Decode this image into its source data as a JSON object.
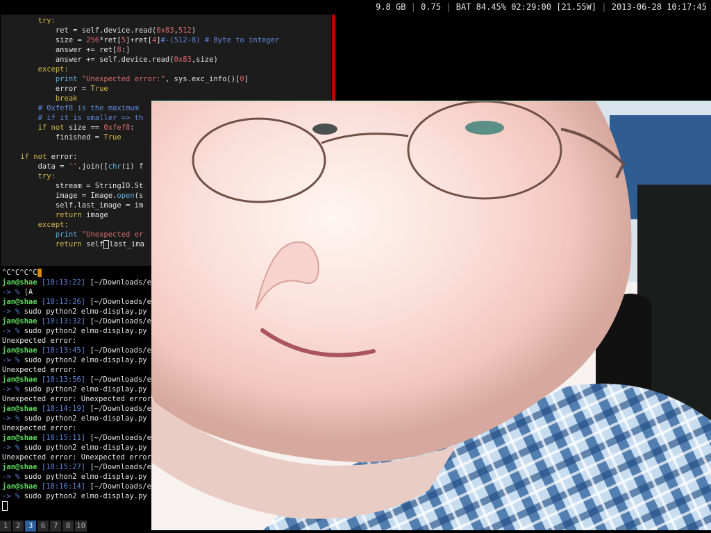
{
  "status": {
    "memory": "9.8 GB",
    "load": "0.75",
    "battery": "BAT 84.45% 02:29:00 [21.55W]",
    "datetime": "2013-06-28 10:17:45"
  },
  "editor": {
    "lines": [
      {
        "indent": "        ",
        "parts": [
          [
            "kw",
            "try:"
          ]
        ]
      },
      {
        "indent": "            ",
        "parts": [
          [
            "",
            "ret = self.device.read("
          ],
          [
            "num",
            "0x83"
          ],
          [
            "",
            ","
          ],
          [
            "num",
            "512"
          ],
          [
            "",
            ")"
          ]
        ]
      },
      {
        "indent": "            ",
        "parts": [
          [
            "",
            "size = "
          ],
          [
            "num",
            "256"
          ],
          [
            "",
            "*ret["
          ],
          [
            "num",
            "5"
          ],
          [
            "",
            "]+ret["
          ],
          [
            "num",
            "4"
          ],
          [
            "",
            "]"
          ],
          [
            "cm",
            "#-(512-8) # Byte to integer"
          ]
        ]
      },
      {
        "indent": "            ",
        "parts": [
          [
            "",
            "answer += ret["
          ],
          [
            "num",
            "8"
          ],
          [
            "",
            ":]"
          ]
        ]
      },
      {
        "indent": "            ",
        "parts": [
          [
            "",
            "answer += self.device.read("
          ],
          [
            "num",
            "0x83"
          ],
          [
            "",
            ",size)"
          ]
        ]
      },
      {
        "indent": "        ",
        "parts": [
          [
            "kw",
            "except:"
          ]
        ]
      },
      {
        "indent": "            ",
        "parts": [
          [
            "blt",
            "print "
          ],
          [
            "str",
            "\"Unexpected error:\""
          ],
          [
            "",
            ", sys.exc_info()["
          ],
          [
            "num",
            "0"
          ],
          [
            "",
            "]"
          ]
        ]
      },
      {
        "indent": "            ",
        "parts": [
          [
            "",
            "error = "
          ],
          [
            "kw",
            "True"
          ]
        ]
      },
      {
        "indent": "            ",
        "parts": [
          [
            "kw",
            "break"
          ]
        ]
      },
      {
        "indent": "        ",
        "parts": [
          [
            "cm",
            "# 0xfef8 is the maximum"
          ]
        ]
      },
      {
        "indent": "        ",
        "parts": [
          [
            "cm",
            "# if it is smaller => th"
          ]
        ]
      },
      {
        "indent": "        ",
        "parts": [
          [
            "kw",
            "if not "
          ],
          [
            "",
            "size == "
          ],
          [
            "num",
            "0xfef8"
          ],
          [
            "",
            ":"
          ]
        ]
      },
      {
        "indent": "            ",
        "parts": [
          [
            "",
            "finished = "
          ],
          [
            "kw",
            "True"
          ]
        ]
      },
      {
        "indent": "",
        "parts": [
          [
            "",
            ""
          ]
        ]
      },
      {
        "indent": "    ",
        "parts": [
          [
            "kw",
            "if not "
          ],
          [
            "",
            "error:"
          ]
        ]
      },
      {
        "indent": "        ",
        "parts": [
          [
            "",
            "data = "
          ],
          [
            "str",
            "''"
          ],
          [
            "",
            ".join(["
          ],
          [
            "blt",
            "chr"
          ],
          [
            "",
            "(i) f"
          ]
        ]
      },
      {
        "indent": "        ",
        "parts": [
          [
            "kw",
            "try:"
          ]
        ]
      },
      {
        "indent": "            ",
        "parts": [
          [
            "",
            "stream = StringIO.St"
          ]
        ]
      },
      {
        "indent": "            ",
        "parts": [
          [
            "",
            "image = Image."
          ],
          [
            "blt",
            "open"
          ],
          [
            "",
            "(s"
          ]
        ]
      },
      {
        "indent": "            ",
        "parts": [
          [
            "",
            "self.last_image = im"
          ]
        ]
      },
      {
        "indent": "            ",
        "parts": [
          [
            "kw",
            "return "
          ],
          [
            "",
            "image"
          ]
        ]
      },
      {
        "indent": "        ",
        "parts": [
          [
            "kw",
            "except:"
          ]
        ]
      },
      {
        "indent": "            ",
        "parts": [
          [
            "blt",
            "print "
          ],
          [
            "str",
            "\"Unexpected er"
          ]
        ]
      },
      {
        "indent": "            ",
        "parts": [
          [
            "kw",
            "return "
          ],
          [
            "",
            "self"
          ],
          [
            "cursor",
            "."
          ],
          [
            "",
            "last_ima"
          ]
        ]
      }
    ]
  },
  "terminal": {
    "interrupt": "^C^C^C^C",
    "lines": [
      {
        "type": "prompt",
        "user": "jan@shae",
        "time": "[10:13:22]",
        "path": "[~/Downloads/elm"
      },
      {
        "type": "cmd",
        "text": "-> % [A"
      },
      {
        "type": "prompt",
        "user": "jan@shae",
        "time": "[10:13:26]",
        "path": "[~/Downloads/elm"
      },
      {
        "type": "cmd",
        "text": "-> % sudo python2 elmo-display.py"
      },
      {
        "type": "prompt",
        "user": "jan@shae",
        "time": "[10:13:32]",
        "path": "[~/Downloads/elm"
      },
      {
        "type": "cmd",
        "text": "-> % sudo python2 elmo-display.py"
      },
      {
        "type": "out",
        "text": "Unexpected error:"
      },
      {
        "type": "prompt",
        "user": "jan@shae",
        "time": "[10:13:45]",
        "path": "[~/Downloads/elm"
      },
      {
        "type": "cmd",
        "text": "-> % sudo python2 elmo-display.py"
      },
      {
        "type": "out",
        "text": "Unexpected error:"
      },
      {
        "type": "prompt",
        "user": "jan@shae",
        "time": "[10:13:56]",
        "path": "[~/Downloads/elm"
      },
      {
        "type": "cmd",
        "text": "-> % sudo python2 elmo-display.py"
      },
      {
        "type": "out",
        "text": "Unexpected error: Unexpected error:"
      },
      {
        "type": "prompt",
        "user": "jan@shae",
        "time": "[10:14:19]",
        "path": "[~/Downloads/elm"
      },
      {
        "type": "cmd",
        "text": "-> % sudo python2 elmo-display.py"
      },
      {
        "type": "out",
        "text": "Unexpected error:"
      },
      {
        "type": "prompt",
        "user": "jan@shae",
        "time": "[10:15:11]",
        "path": "[~/Downloads/elm"
      },
      {
        "type": "cmd",
        "text": "-> % sudo python2 elmo-display.py"
      },
      {
        "type": "out",
        "text": "Unexpected error: Unexpected error:"
      },
      {
        "type": "prompt",
        "user": "jan@shae",
        "time": "[10:15:27]",
        "path": "[~/Downloads/elm"
      },
      {
        "type": "cmd",
        "text": "-> % sudo python2 elmo-display.py"
      },
      {
        "type": "prompt",
        "user": "jan@shae",
        "time": "[10:16:14]",
        "path": "[~/Downloads/elm"
      },
      {
        "type": "cmd",
        "text": "-> % sudo python2 elmo-display.py"
      }
    ]
  },
  "workspaces": {
    "items": [
      "1",
      "2",
      "3",
      "6",
      "7",
      "8",
      "10"
    ],
    "active": "3"
  }
}
